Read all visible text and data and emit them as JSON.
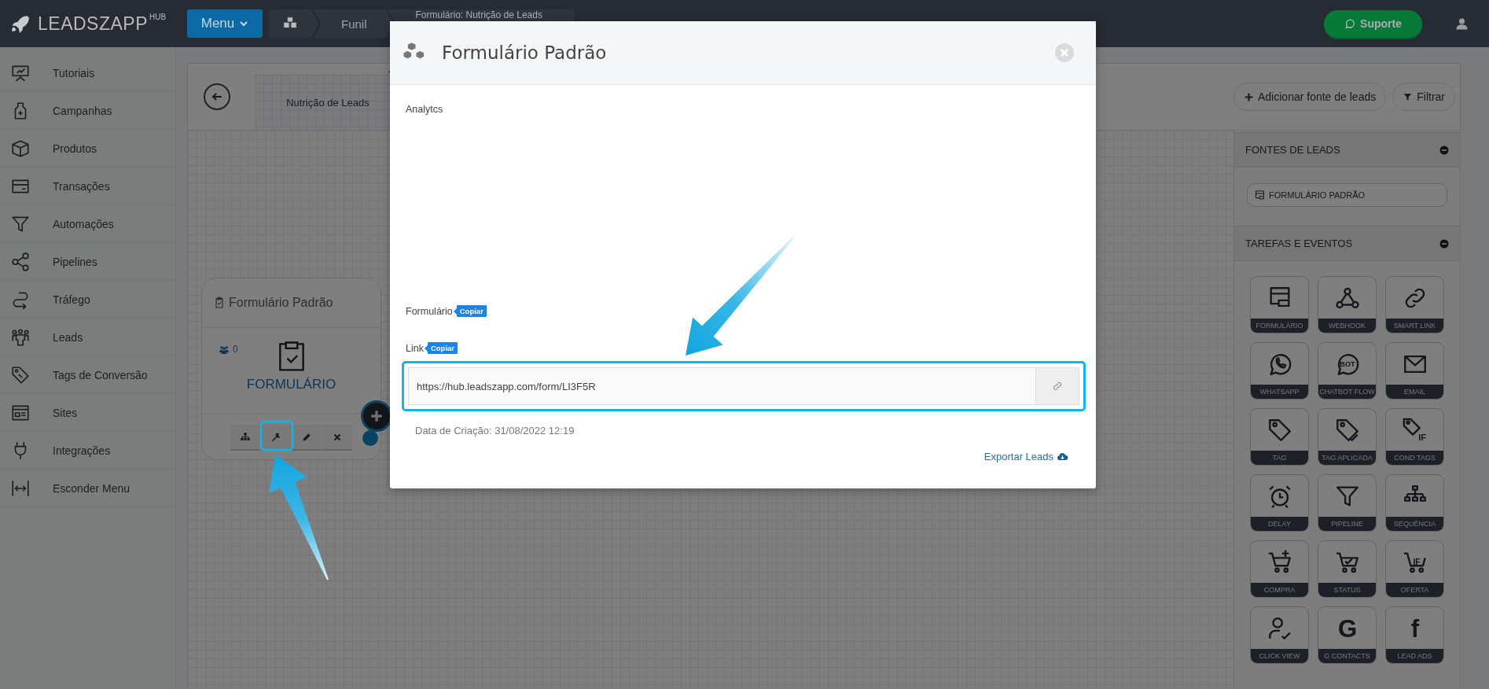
{
  "brand": {
    "name": "LEADSZAPP",
    "suffix": "HUB"
  },
  "topbar": {
    "menu_button": "Menu",
    "breadcrumb": [
      "Funil",
      "Formulário: Nutrição de Leads"
    ],
    "support_button": "Suporte"
  },
  "sidebar": {
    "items": [
      {
        "label": "Tutoriais"
      },
      {
        "label": "Campanhas"
      },
      {
        "label": "Produtos"
      },
      {
        "label": "Transações"
      },
      {
        "label": "Automações"
      },
      {
        "label": "Pipelines"
      },
      {
        "label": "Tráfego"
      },
      {
        "label": "Leads"
      },
      {
        "label": "Tags de Conversão"
      },
      {
        "label": "Sites"
      },
      {
        "label": "Integrações"
      },
      {
        "label": "Esconder Menu"
      }
    ]
  },
  "funnel": {
    "tab": "Nutrição de Leads",
    "actions": [
      "Adicionar fonte de leads",
      "Filtrar"
    ]
  },
  "node": {
    "title": "Formulário Padrão",
    "count": "0",
    "type_label": "FORMULÁRIO"
  },
  "panel": {
    "sources_title": "FONTES DE LEADS",
    "sources": [
      "FORMULÁRIO PADRÃO"
    ],
    "tasks_title": "TAREFAS E EVENTOS",
    "tiles": [
      {
        "label": "FORMULÁRIO"
      },
      {
        "label": "WEBHOOK"
      },
      {
        "label": "SMART LINK"
      },
      {
        "label": "WHATSAPP"
      },
      {
        "label": "CHATBOT FLOW",
        "glyph": "BOT"
      },
      {
        "label": "EMAIL"
      },
      {
        "label": "TAG"
      },
      {
        "label": "TAG APLICADA"
      },
      {
        "label": "COND TAGS",
        "glyph": "IF"
      },
      {
        "label": "DELAY"
      },
      {
        "label": "PIPELINE"
      },
      {
        "label": "SEQUÊNCIA"
      },
      {
        "label": "COMPRA"
      },
      {
        "label": "STATUS"
      },
      {
        "label": "OFERTA",
        "glyph": "IF"
      },
      {
        "label": "CLICK VIEW"
      },
      {
        "label": "G CONTACTS",
        "glyph": "G"
      },
      {
        "label": "LEAD ADS",
        "glyph": "f"
      }
    ]
  },
  "modal": {
    "title": "Formulário Padrão",
    "analytics_label": "Analytcs",
    "form_label": "Formulário",
    "form_copy": "Copiar",
    "link_label": "Link",
    "link_copy": "Copiar",
    "link_value": "https://hub.leadszapp.com/form/LI3F5R",
    "created": "Data de Criação: 31/08/2022 12:19",
    "export": "Exportar Leads"
  }
}
